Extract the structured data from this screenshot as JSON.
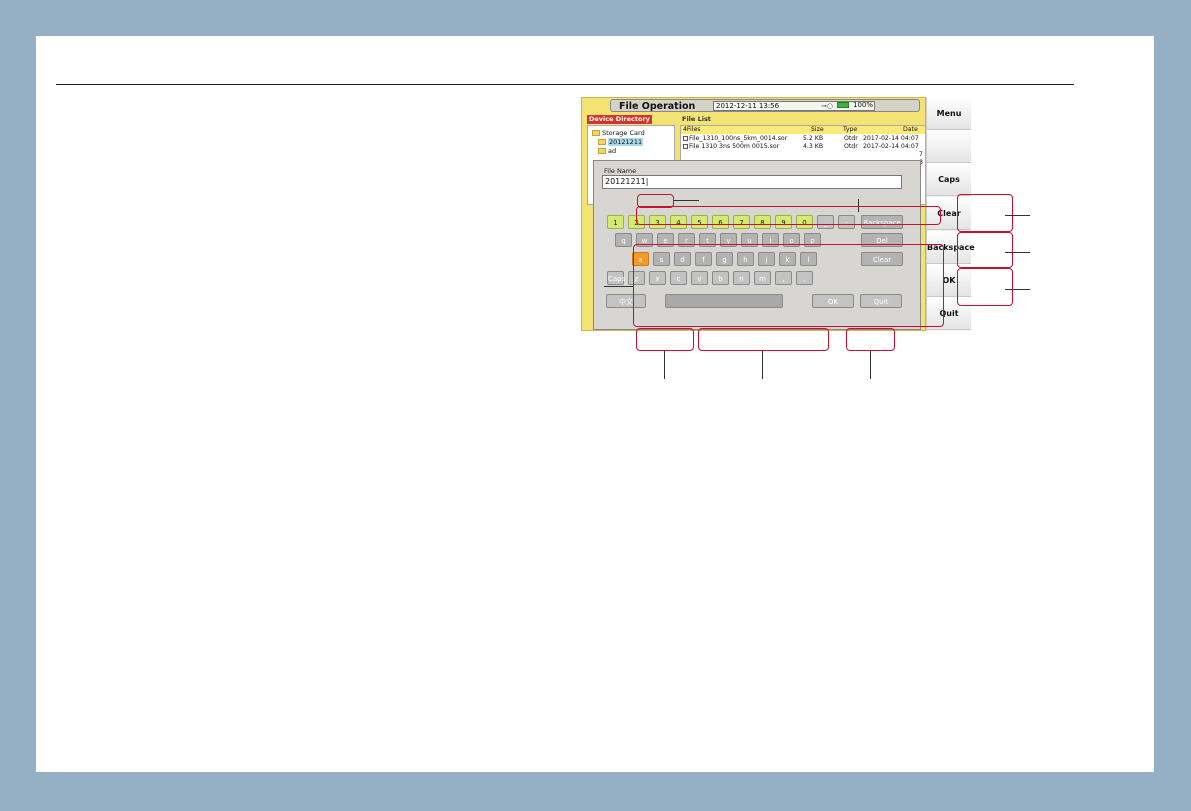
{
  "screen": {
    "title": "File Operation",
    "datetime": "2012-12-11 13:56",
    "plug_glyph": "⊸○",
    "battery": "100%"
  },
  "device_directory": {
    "label": "Device Directory",
    "items": [
      "Storage Card",
      "20121211",
      "ad"
    ]
  },
  "file_list": {
    "label": "File List",
    "header": {
      "count": "4Files",
      "size": "Size",
      "type": "Type",
      "date": "Date"
    },
    "rows": [
      {
        "name": "File_1310_100ns_5km_0014.sor",
        "size": "5.2 KB",
        "type": "Otdr",
        "date": "2017-02-14 04:07"
      },
      {
        "name": "File 1310 3ns 500m 0015.sor",
        "size": "4.3 KB",
        "type": "Otdr",
        "date": "2017-02-14 04:07"
      }
    ],
    "trailing": [
      "7",
      "8"
    ]
  },
  "dialog": {
    "file_name_label": "File Name",
    "file_name_value": "20121211|",
    "num_row": [
      "1",
      "2",
      "3",
      "4",
      "5",
      "6",
      "7",
      "8",
      "9",
      "0",
      "_",
      "-"
    ],
    "row_q": [
      "q",
      "w",
      "e",
      "r",
      "t",
      "y",
      "u",
      "i",
      "o",
      "p"
    ],
    "row_a": [
      "a",
      "s",
      "d",
      "f",
      "g",
      "h",
      "j",
      "k",
      "l"
    ],
    "row_z": [
      "Caps",
      "z",
      "x",
      "c",
      "v",
      "b",
      "n",
      "m",
      ",",
      "."
    ],
    "side_keys": [
      "Backspace",
      "Del",
      "Clear"
    ],
    "bottom": {
      "lang": "中文",
      "space": "",
      "ok": "OK",
      "quit": "Quit"
    }
  },
  "softkeys": [
    "Menu",
    "",
    "Caps",
    "Clear",
    "Backspace",
    "OK",
    "Quit"
  ],
  "colors": {
    "callout": "#c8102e",
    "num_key": "#d4ea73",
    "active_key": "#f29a2c",
    "screen_bg": "#f3e372"
  }
}
